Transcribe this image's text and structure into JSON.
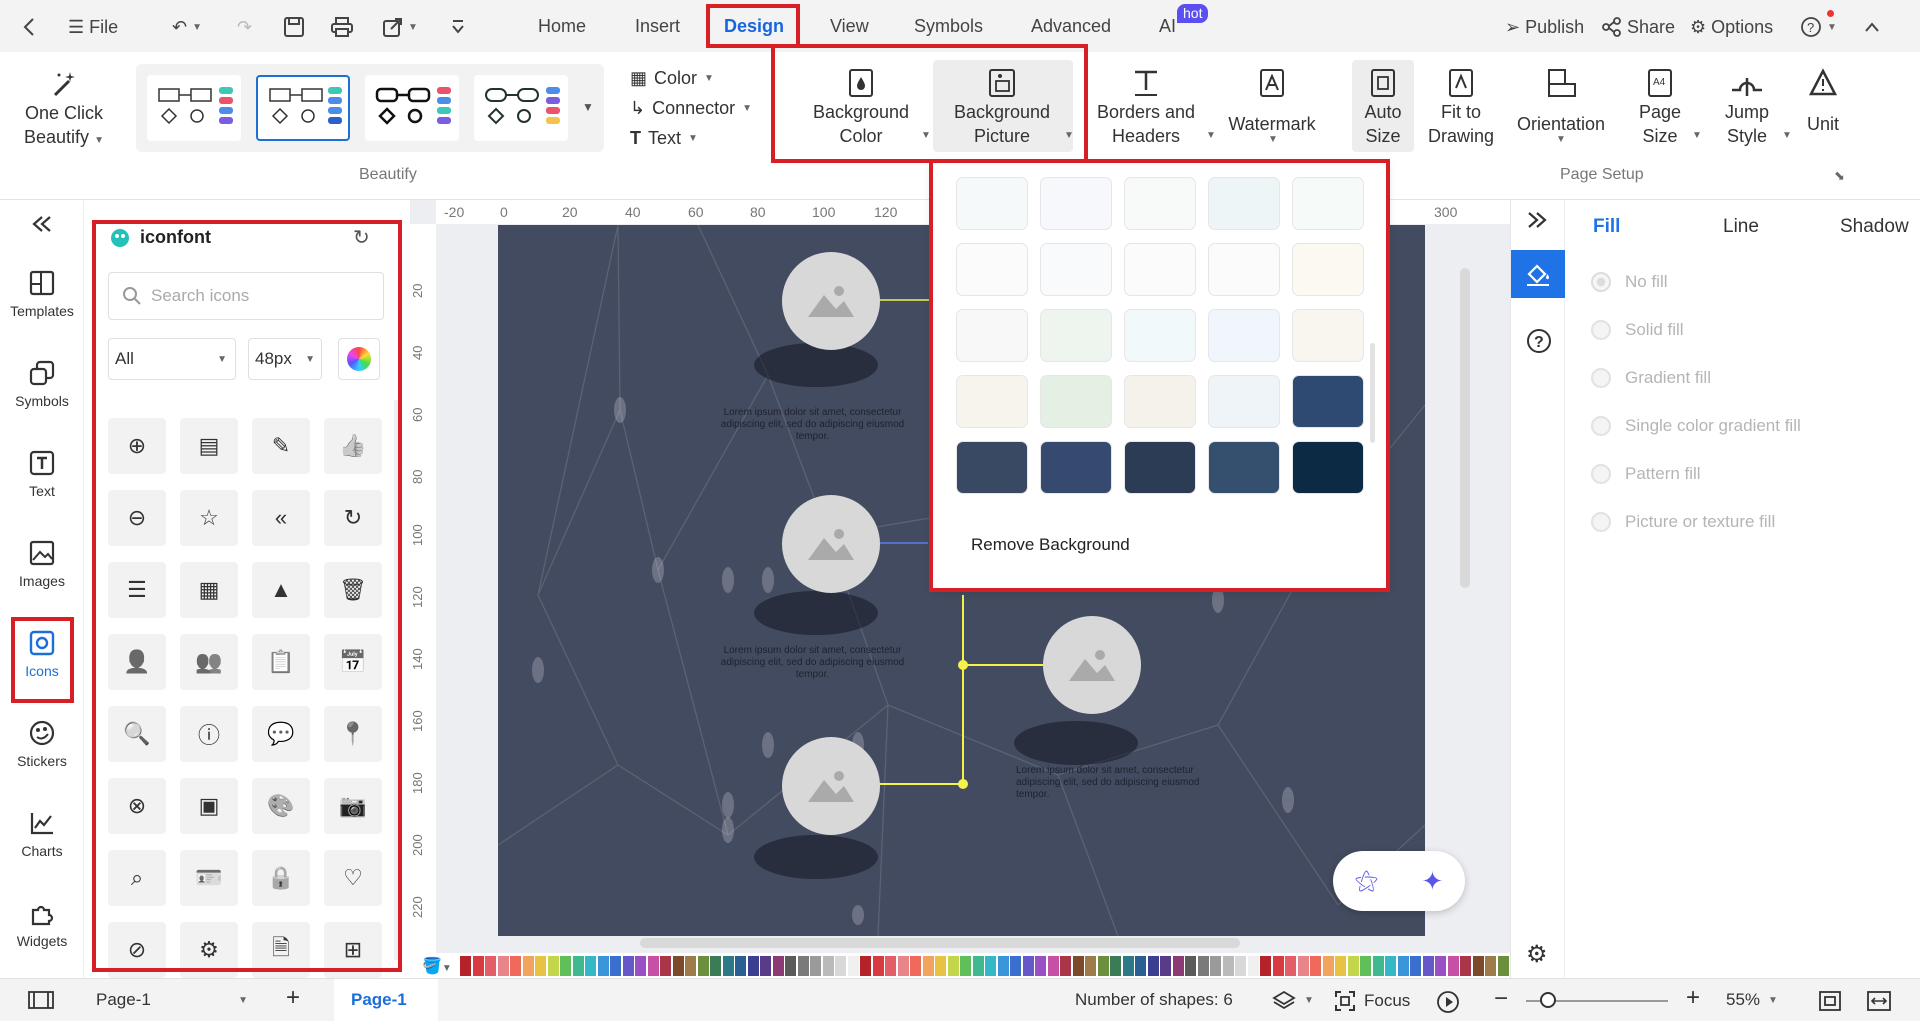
{
  "topbar": {
    "file": "File",
    "tabs": [
      "Home",
      "Insert",
      "Design",
      "View",
      "Symbols",
      "Advanced",
      "AI"
    ],
    "hot": "hot",
    "publish": "Publish",
    "share": "Share",
    "options": "Options"
  },
  "ribbon": {
    "one_click": [
      "One Click",
      "Beautify"
    ],
    "color": "Color",
    "connector": "Connector",
    "text": "Text",
    "beautify_group": "Beautify",
    "bg_color": [
      "Background",
      "Color"
    ],
    "bg_picture": [
      "Background",
      "Picture"
    ],
    "borders": [
      "Borders and",
      "Headers"
    ],
    "watermark": "Watermark",
    "auto_size": [
      "Auto",
      "Size"
    ],
    "fit": [
      "Fit to",
      "Drawing"
    ],
    "orientation": "Orientation",
    "page_size": [
      "Page",
      "Size"
    ],
    "jump": [
      "Jump",
      "Style"
    ],
    "unit": "Unit",
    "page_setup_group": "Page Setup"
  },
  "leftnav": [
    "Templates",
    "Symbols",
    "Text",
    "Images",
    "Icons",
    "Stickers",
    "Charts",
    "Widgets"
  ],
  "icons_panel": {
    "title": "iconfont",
    "search_placeholder": "Search icons",
    "filter": "All",
    "size": "48px",
    "icons": [
      "zoom-in-icon",
      "document-icon",
      "edit-icon",
      "thumbs-up-icon",
      "zoom-out-icon",
      "star-icon",
      "double-chevron-left-icon",
      "refresh-icon",
      "list-icon",
      "apps-icon",
      "triangle-up-icon",
      "trash-icon",
      "user-icon",
      "user-group-icon",
      "clipboard-icon",
      "calendar-icon",
      "report-search-icon",
      "alert-icon",
      "chat-icon",
      "location-icon",
      "close-circle-icon",
      "calendar-filled-icon",
      "palette-icon",
      "camera-icon",
      "search-icon",
      "id-card-icon",
      "lock-icon",
      "heart-icon",
      "prohibit-icon",
      "settings-icon",
      "doc-settings-icon",
      "grid-icon"
    ]
  },
  "ruler": {
    "h": [
      "-20",
      "0",
      "20",
      "40",
      "60",
      "80",
      "100",
      "120",
      "300"
    ],
    "v": [
      "20",
      "40",
      "60",
      "80",
      "100",
      "120",
      "140",
      "160",
      "180",
      "200",
      "220"
    ]
  },
  "canvas": {
    "lorem": "Lorem ipsum dolor sit amet, consectetur adipiscing elit, sed do adipiscing eiusmod tempor."
  },
  "bg_dropdown": {
    "remove": "Remove Background",
    "thumb_colors": [
      "#f6f9f9",
      "#f6f8fb",
      "#f7faf9",
      "#eef5f7",
      "#f6faf9",
      "#fbfbfb",
      "#f8fafc",
      "#fbfbfb",
      "#fbfbfb",
      "#fcfaf0",
      "#f7f8f7",
      "#eef5ef",
      "#f2f9fb",
      "#f1f6fc",
      "#f9f6f0",
      "#f6f4ec",
      "#e4f0e4",
      "#f4f2ea",
      "#eef4f8",
      "#2e4a73",
      "#394863",
      "#36496e",
      "#2c3c55",
      "#35506f",
      "#0d2a45"
    ]
  },
  "right_panel": {
    "tabs": [
      "Fill",
      "Line",
      "Shadow"
    ],
    "options": [
      "No fill",
      "Solid fill",
      "Gradient fill",
      "Single color gradient fill",
      "Pattern fill",
      "Picture or texture fill"
    ]
  },
  "palette": [
    "#b4232a",
    "#d93a3f",
    "#e35e66",
    "#e8848a",
    "#ef6a5a",
    "#f2a35c",
    "#e8c245",
    "#c4d54a",
    "#5fbf5a",
    "#3fb98f",
    "#35b8c5",
    "#3a96d8",
    "#3a6fd0",
    "#6658c8",
    "#9a4fc4",
    "#c750a7",
    "#a83548",
    "#7c4a2a",
    "#9e7c4a",
    "#6b8f3c",
    "#3b7b57",
    "#2d7a86",
    "#2b5f93",
    "#3a3f8f",
    "#5a3b8a",
    "#8c3a74",
    "#5a5a5a",
    "#7a7a7a",
    "#9a9a9a",
    "#bababa",
    "#d8d8d8",
    "#f0f0f0"
  ],
  "status": {
    "page_sel": "Page-1",
    "page_tab": "Page-1",
    "shapes": "Number of shapes: 6",
    "focus": "Focus",
    "zoom": "55%"
  }
}
